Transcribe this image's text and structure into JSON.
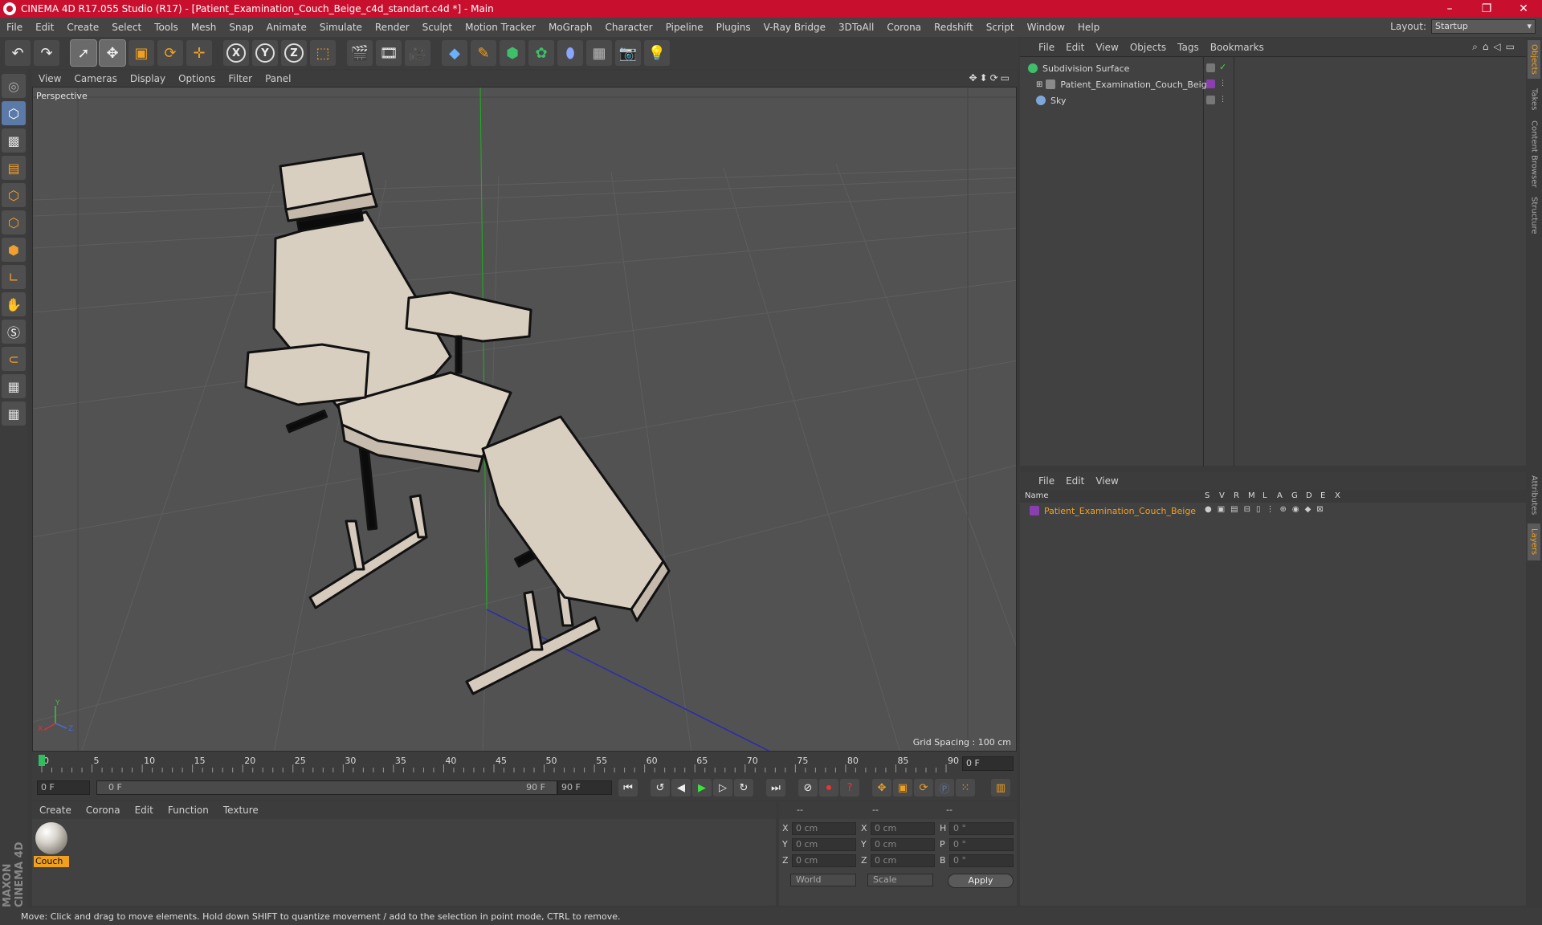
{
  "window": {
    "title": "CINEMA 4D R17.055 Studio (R17) - [Patient_Examination_Couch_Beige_c4d_standart.c4d *] - Main",
    "controls": [
      "–",
      "❐",
      "✕"
    ]
  },
  "menubar": {
    "items": [
      "File",
      "Edit",
      "Create",
      "Select",
      "Tools",
      "Mesh",
      "Snap",
      "Animate",
      "Simulate",
      "Render",
      "Sculpt",
      "Motion Tracker",
      "MoGraph",
      "Character",
      "Pipeline",
      "Plugins",
      "V-Ray Bridge",
      "3DToAll",
      "Corona",
      "Redshift",
      "Script",
      "Window",
      "Help"
    ],
    "layout_label": "Layout:",
    "layout_value": "Startup"
  },
  "viewport": {
    "menu": [
      "View",
      "Cameras",
      "Display",
      "Options",
      "Filter",
      "Panel"
    ],
    "label": "Perspective",
    "grid_spacing": "Grid Spacing : 100 cm",
    "axis_labels": [
      "Y",
      "X",
      "Z"
    ]
  },
  "timeline": {
    "ticks": [
      "0",
      "5",
      "10",
      "15",
      "20",
      "25",
      "30",
      "35",
      "40",
      "45",
      "50",
      "55",
      "60",
      "65",
      "70",
      "75",
      "80",
      "85",
      "90"
    ],
    "current_frame": "0 F",
    "start_field": "0 F",
    "range_start": "0 F",
    "range_end": "90 F",
    "end_field": "90 F"
  },
  "material_manager": {
    "menu": [
      "Create",
      "Corona",
      "Edit",
      "Function",
      "Texture"
    ],
    "materials": [
      {
        "name": "Couch"
      }
    ]
  },
  "coordinates": {
    "header": [
      "--",
      "--",
      "--"
    ],
    "rows": [
      {
        "axis": "X",
        "pos": "0 cm",
        "axis2": "X",
        "size": "0 cm",
        "rot_label": "H",
        "rot": "0 °"
      },
      {
        "axis": "Y",
        "pos": "0 cm",
        "axis2": "Y",
        "size": "0 cm",
        "rot_label": "P",
        "rot": "0 °"
      },
      {
        "axis": "Z",
        "pos": "0 cm",
        "axis2": "Z",
        "size": "0 cm",
        "rot_label": "B",
        "rot": "0 °"
      }
    ],
    "mode_world": "World",
    "mode_scale": "Scale",
    "apply": "Apply"
  },
  "object_manager": {
    "menu": [
      "File",
      "Edit",
      "View",
      "Objects",
      "Tags",
      "Bookmarks"
    ],
    "objects": [
      {
        "name": "Subdivision Surface",
        "color": "#3fbf6a"
      },
      {
        "name": "Patient_Examination_Couch_Beige",
        "color": "#8a8a8a"
      },
      {
        "name": "Sky",
        "color": "#7fa6d8"
      }
    ]
  },
  "layer_manager": {
    "menu": [
      "File",
      "Edit",
      "View"
    ],
    "columns": [
      "Name",
      "S",
      "V",
      "R",
      "M",
      "L",
      "A",
      "G",
      "D",
      "E",
      "X"
    ],
    "layers": [
      {
        "name": "Patient_Examination_Couch_Beige",
        "color": "#8a3fb0"
      }
    ]
  },
  "right_tabs": [
    "Objects",
    "Takes",
    "Content Browser",
    "Structure",
    "Attributes",
    "Layers"
  ],
  "statusbar": {
    "text": "Move: Click and drag to move elements. Hold down SHIFT to quantize movement / add to the selection in point mode, CTRL to remove."
  },
  "colors": {
    "title_bar": "#c8102e",
    "accent_orange": "#f0a020",
    "couch": "#d9cfc1",
    "viewport_bg": "#525252"
  }
}
